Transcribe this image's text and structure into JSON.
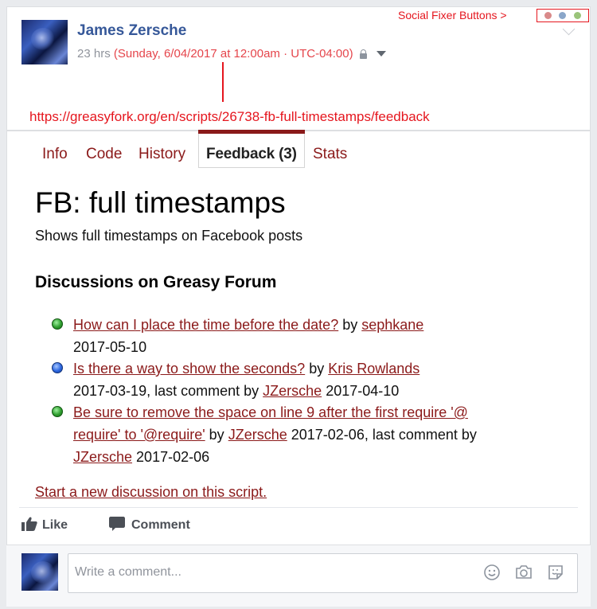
{
  "post": {
    "author": "James Zersche",
    "time_ago": "23 hrs",
    "full_timestamp": "(Sunday, 6/04/2017 at 12:00am · UTC-04:00)"
  },
  "annotations": {
    "social_fixer_label": "Social Fixer Buttons >",
    "url": "https://greasyfork.org/en/scripts/26738-fb-full-timestamps/feedback",
    "social_fixer_dot_colors": [
      "#d98a8a",
      "#8aa6c9",
      "#9ac47a"
    ]
  },
  "tabs": [
    {
      "label": "Info"
    },
    {
      "label": "Code"
    },
    {
      "label": "History"
    },
    {
      "label": "Feedback (3)",
      "active": true
    },
    {
      "label": "Stats"
    }
  ],
  "script": {
    "title": "FB: full timestamps",
    "description": "Shows full timestamps on Facebook posts"
  },
  "discussions": {
    "heading": "Discussions on Greasy Forum",
    "items": [
      {
        "status": "green",
        "title": "How can I place the time before the date?",
        "by": "by",
        "author": "sephkane",
        "date": "2017-05-10"
      },
      {
        "status": "blue",
        "title": "Is there a way to show the seconds?",
        "by": "by",
        "author": "Kris Rowlands",
        "date": "2017-03-19, last comment by",
        "last_commenter": "JZersche",
        "last_date": "2017-04-10"
      },
      {
        "status": "green",
        "title_line1": "Be sure to remove the space on line 9 after the first require '@",
        "title_line2": "require' to '@require'",
        "by": "by",
        "author": "JZersche",
        "date": "2017-02-06, last comment by",
        "last_commenter": "JZersche",
        "last_date": "2017-02-06"
      }
    ],
    "new_discussion": "Start a new discussion on this script."
  },
  "actions": {
    "like": "Like",
    "comment": "Comment"
  },
  "comment_box": {
    "placeholder": "Write a comment..."
  },
  "colors": {
    "fb_blue": "#365899",
    "annotation_red": "#e5161e",
    "link_maroon": "#8b1a1a"
  }
}
